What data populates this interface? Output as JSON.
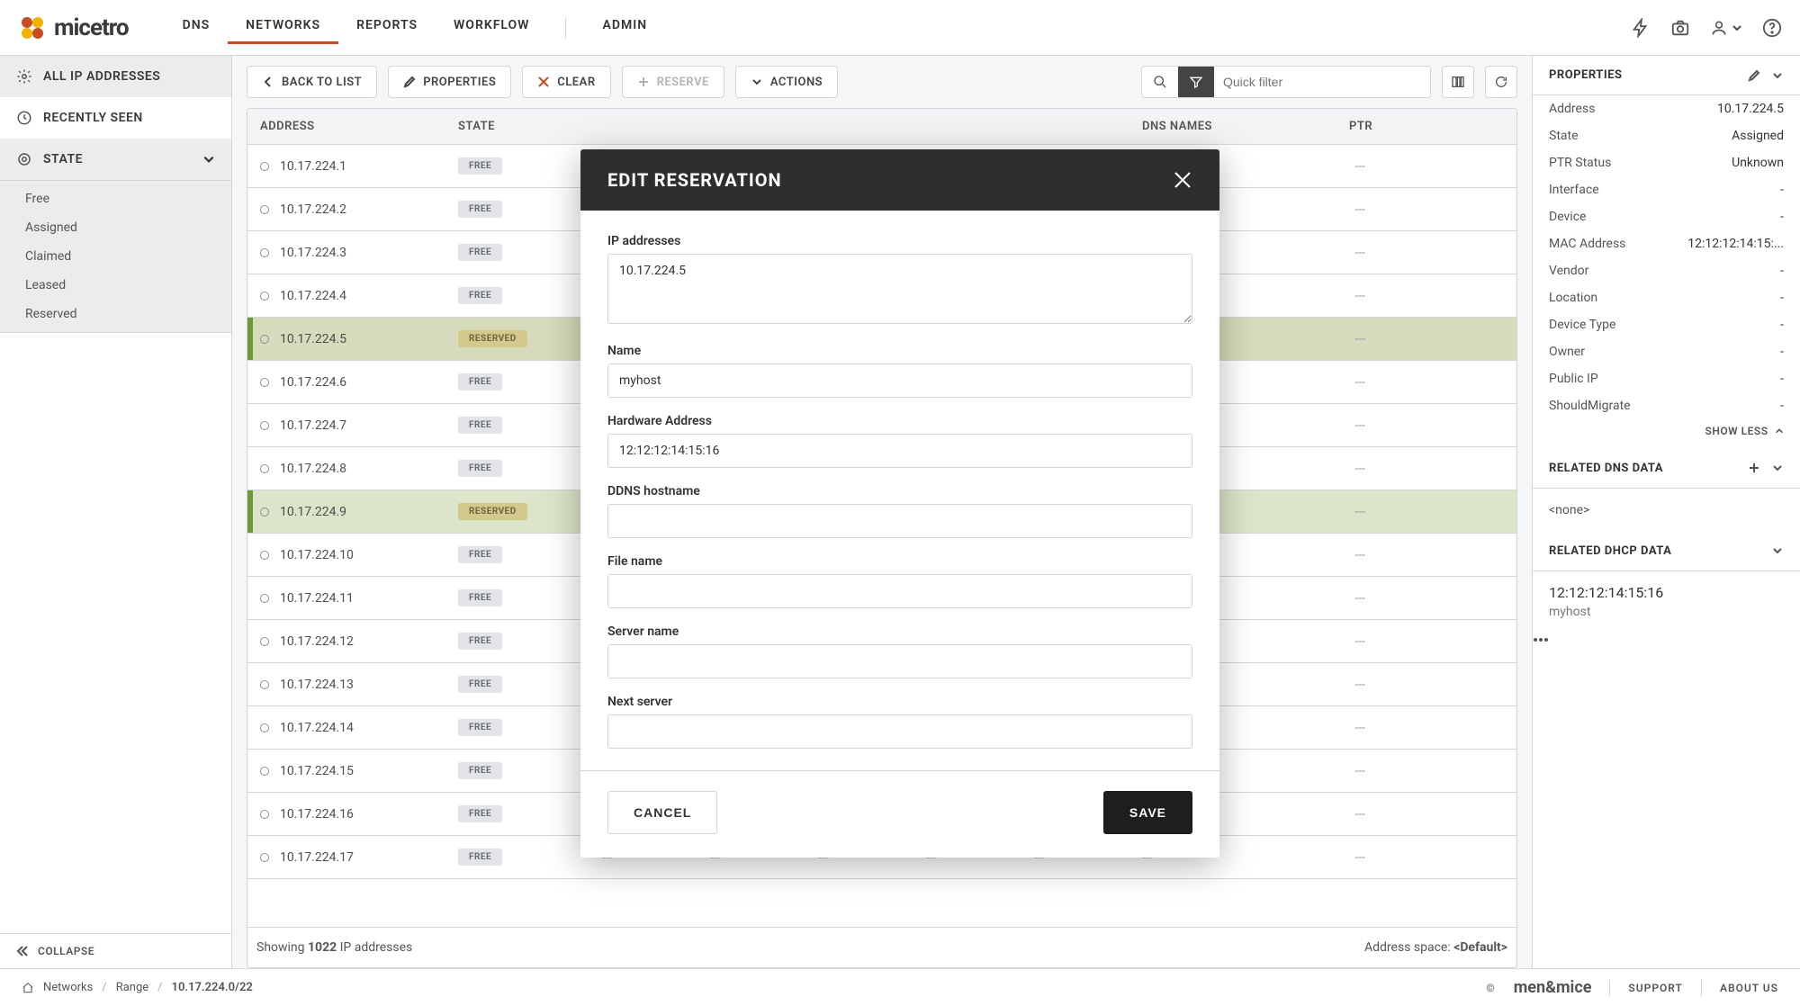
{
  "nav": {
    "logo_text": "micetro",
    "items": [
      "DNS",
      "NETWORKS",
      "REPORTS",
      "WORKFLOW",
      "ADMIN"
    ],
    "active_index": 1
  },
  "sidebar": {
    "items": [
      {
        "id": "all-ip",
        "label": "ALL IP ADDRESSES",
        "icon": "gear-icon"
      },
      {
        "id": "recent",
        "label": "RECENTLY SEEN",
        "icon": "clock-icon"
      },
      {
        "id": "state",
        "label": "STATE",
        "icon": "target-icon",
        "expandable": true
      }
    ],
    "active_id": "all-ip",
    "state_filters": [
      "Free",
      "Assigned",
      "Claimed",
      "Leased",
      "Reserved"
    ],
    "collapse_label": "COLLAPSE"
  },
  "toolbar": {
    "back_label": "BACK TO LIST",
    "properties_label": "PROPERTIES",
    "clear_label": "CLEAR",
    "reserve_label": "RESERVE",
    "actions_label": "ACTIONS",
    "search_placeholder": "Quick filter"
  },
  "table": {
    "columns": [
      "ADDRESS",
      "STATE",
      "DNS NAMES",
      "PTR"
    ],
    "rows": [
      {
        "ip": "10.17.224.1",
        "state": "FREE"
      },
      {
        "ip": "10.17.224.2",
        "state": "FREE"
      },
      {
        "ip": "10.17.224.3",
        "state": "FREE"
      },
      {
        "ip": "10.17.224.4",
        "state": "FREE"
      },
      {
        "ip": "10.17.224.5",
        "state": "RESERVED",
        "selected": true
      },
      {
        "ip": "10.17.224.6",
        "state": "FREE"
      },
      {
        "ip": "10.17.224.7",
        "state": "FREE"
      },
      {
        "ip": "10.17.224.8",
        "state": "FREE"
      },
      {
        "ip": "10.17.224.9",
        "state": "RESERVED"
      },
      {
        "ip": "10.17.224.10",
        "state": "FREE"
      },
      {
        "ip": "10.17.224.11",
        "state": "FREE"
      },
      {
        "ip": "10.17.224.12",
        "state": "FREE"
      },
      {
        "ip": "10.17.224.13",
        "state": "FREE"
      },
      {
        "ip": "10.17.224.14",
        "state": "FREE"
      },
      {
        "ip": "10.17.224.15",
        "state": "FREE"
      },
      {
        "ip": "10.17.224.16",
        "state": "FREE"
      },
      {
        "ip": "10.17.224.17",
        "state": "FREE"
      }
    ],
    "dash": "---",
    "footer": {
      "showing_prefix": "Showing ",
      "count": "1022",
      "showing_suffix": " IP addresses",
      "space_label": "Address space: ",
      "space_value": "<Default>"
    }
  },
  "props": {
    "title": "PROPERTIES",
    "rows": [
      {
        "k": "Address",
        "v": "10.17.224.5"
      },
      {
        "k": "State",
        "v": "Assigned"
      },
      {
        "k": "PTR Status",
        "v": "Unknown"
      },
      {
        "k": "Interface",
        "v": "-"
      },
      {
        "k": "Device",
        "v": "-"
      },
      {
        "k": "MAC Address",
        "v": "12:12:12:14:15:..."
      },
      {
        "k": "Vendor",
        "v": "-"
      },
      {
        "k": "Location",
        "v": "-"
      },
      {
        "k": "Device Type",
        "v": "-"
      },
      {
        "k": "Owner",
        "v": "-"
      },
      {
        "k": "Public IP",
        "v": "-"
      },
      {
        "k": "ShouldMigrate",
        "v": "-"
      }
    ],
    "show_less": "SHOW LESS",
    "dns_title": "RELATED DNS DATA",
    "none": "<none>",
    "dhcp_title": "RELATED DHCP DATA",
    "dhcp_item": {
      "mac": "12:12:12:14:15:16",
      "name": "myhost"
    }
  },
  "dialog": {
    "title": "EDIT RESERVATION",
    "ip_label": "IP addresses",
    "ip_value": "10.17.224.5",
    "name_label": "Name",
    "name_value": "myhost",
    "hw_label": "Hardware Address",
    "hw_value": "12:12:12:14:15:16",
    "ddns_label": "DDNS hostname",
    "ddns_value": "",
    "file_label": "File name",
    "file_value": "",
    "server_label": "Server name",
    "server_value": "",
    "next_label": "Next server",
    "next_value": "",
    "cancel": "CANCEL",
    "save": "SAVE"
  },
  "breadcrumb": {
    "items": [
      "Networks",
      "Range",
      "10.17.224.0/22"
    ]
  },
  "footer": {
    "company_prefix": "©",
    "company": "men&mice",
    "support": "SUPPORT",
    "about": "ABOUT US"
  },
  "pill_text": {
    "FREE": "FREE",
    "RESERVED": "RESERVED"
  }
}
